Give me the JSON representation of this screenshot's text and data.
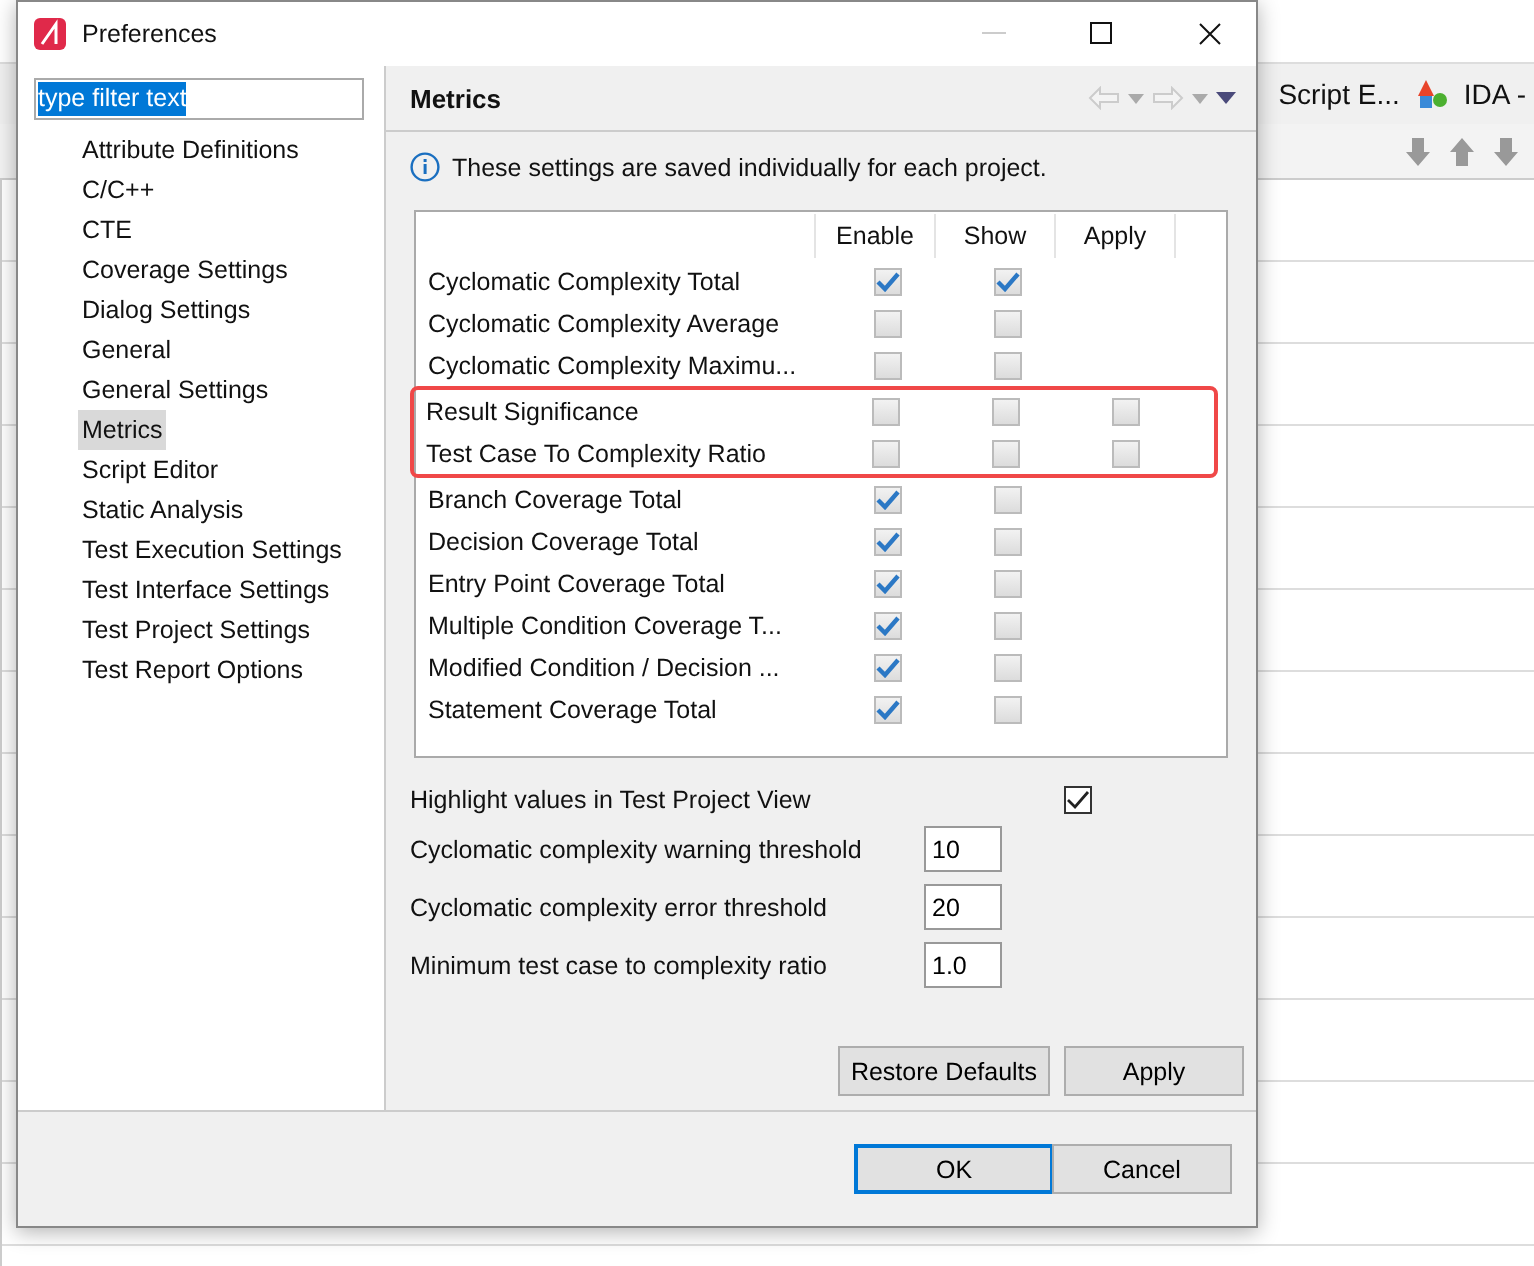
{
  "background_app": {
    "tabs": [
      "Script E...",
      "IDA -"
    ]
  },
  "window": {
    "title": "Preferences"
  },
  "filter": {
    "value": "type filter text"
  },
  "tree": [
    {
      "label": "Attribute Definitions",
      "selected": false
    },
    {
      "label": "C/C++",
      "selected": false
    },
    {
      "label": "CTE",
      "selected": false
    },
    {
      "label": "Coverage Settings",
      "selected": false
    },
    {
      "label": "Dialog Settings",
      "selected": false
    },
    {
      "label": "General",
      "selected": false
    },
    {
      "label": "General Settings",
      "selected": false
    },
    {
      "label": "Metrics",
      "selected": true
    },
    {
      "label": "Script Editor",
      "selected": false
    },
    {
      "label": "Static Analysis",
      "selected": false
    },
    {
      "label": "Test Execution Settings",
      "selected": false
    },
    {
      "label": "Test Interface Settings",
      "selected": false
    },
    {
      "label": "Test Project Settings",
      "selected": false
    },
    {
      "label": "Test Report Options",
      "selected": false
    }
  ],
  "page": {
    "title": "Metrics",
    "info": "These settings are saved individually for each project."
  },
  "table": {
    "columns": [
      "Enable",
      "Show",
      "Apply"
    ],
    "rows": [
      {
        "name": "Cyclomatic Complexity Total",
        "enable": true,
        "show": true,
        "highlighted": false
      },
      {
        "name": "Cyclomatic Complexity Average",
        "enable": false,
        "show": false,
        "highlighted": false
      },
      {
        "name": "Cyclomatic Complexity Maximu...",
        "enable": false,
        "show": false,
        "highlighted": false
      },
      {
        "name": "Result Significance",
        "enable": false,
        "show": false,
        "apply": false,
        "highlighted": true
      },
      {
        "name": "Test Case To Complexity Ratio",
        "enable": false,
        "show": false,
        "apply": false,
        "highlighted": true
      },
      {
        "name": "Branch Coverage Total",
        "enable": true,
        "show": false,
        "highlighted": false
      },
      {
        "name": "Decision Coverage Total",
        "enable": true,
        "show": false,
        "highlighted": false
      },
      {
        "name": "Entry Point Coverage Total",
        "enable": true,
        "show": false,
        "highlighted": false
      },
      {
        "name": "Multiple Condition Coverage T...",
        "enable": true,
        "show": false,
        "highlighted": false
      },
      {
        "name": "Modified Condition / Decision ...",
        "enable": true,
        "show": false,
        "highlighted": false
      },
      {
        "name": "Statement Coverage Total",
        "enable": true,
        "show": false,
        "highlighted": false
      }
    ]
  },
  "options": [
    {
      "kind": "checkbox",
      "label": "Highlight values in Test Project View",
      "checked": true
    },
    {
      "kind": "field",
      "label": "Cyclomatic complexity warning threshold",
      "value": "10"
    },
    {
      "kind": "field",
      "label": "Cyclomatic complexity error threshold",
      "value": "20"
    },
    {
      "kind": "field",
      "label": "Minimum test case to complexity ratio",
      "value": "1.0"
    }
  ],
  "page_buttons": [
    "Restore Defaults",
    "Apply"
  ],
  "dialog_buttons": [
    {
      "label": "OK",
      "default": true
    },
    {
      "label": "Cancel",
      "default": false
    }
  ]
}
